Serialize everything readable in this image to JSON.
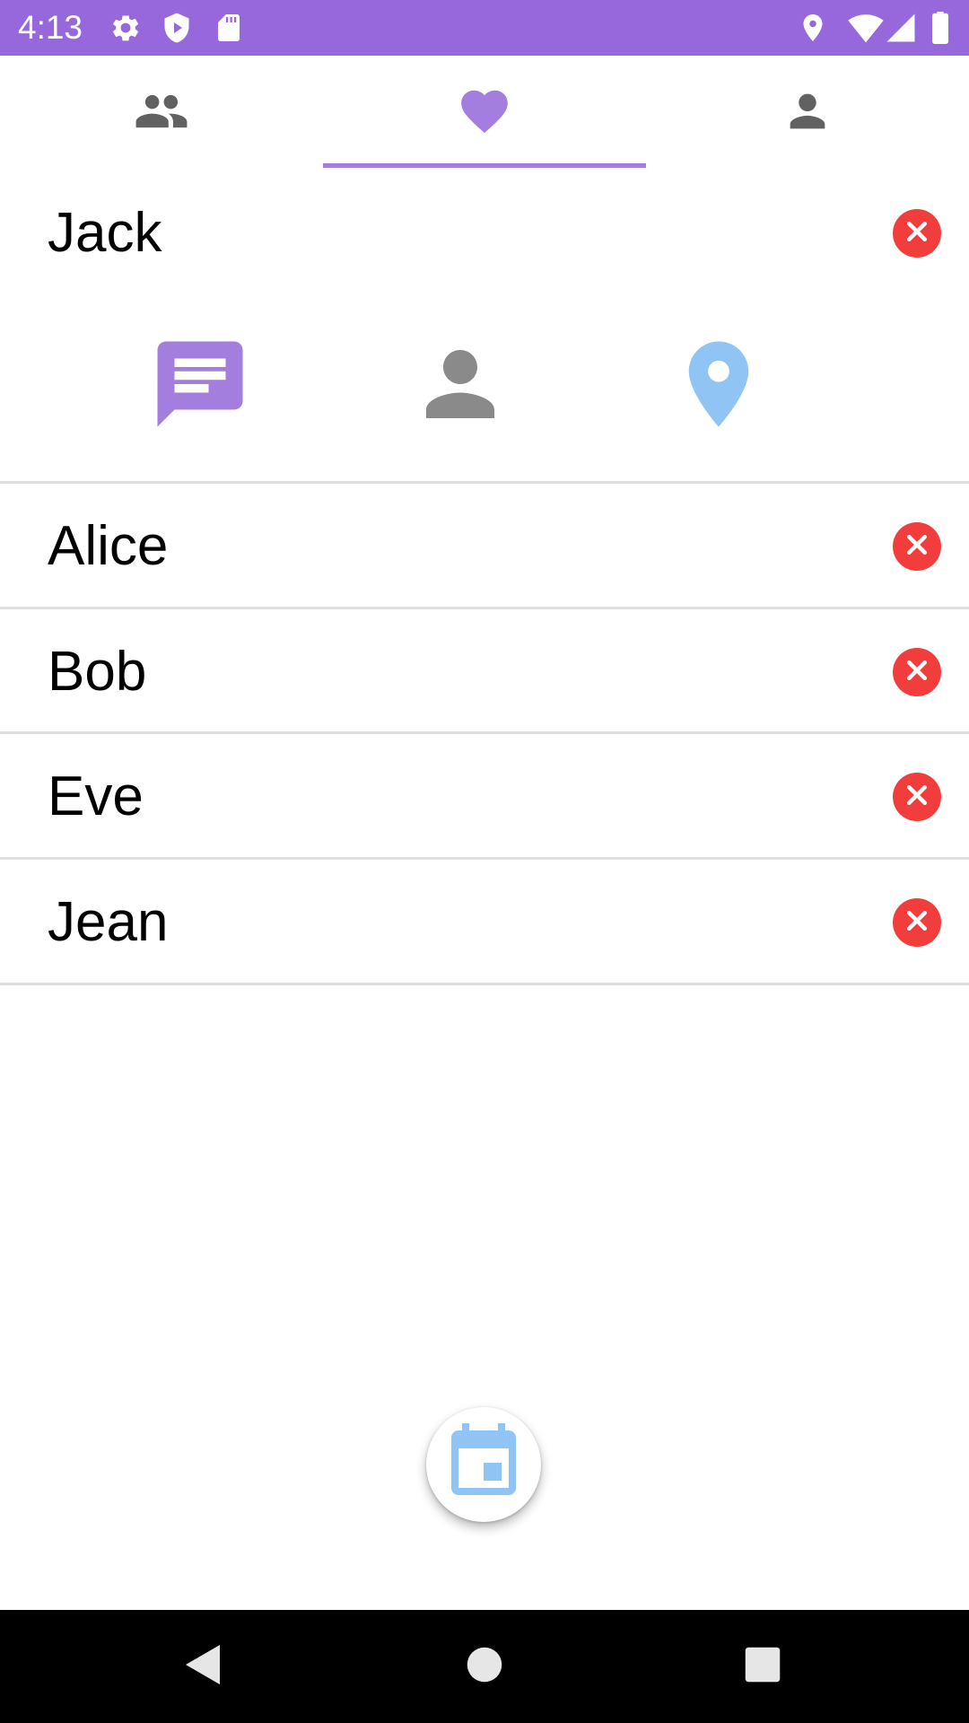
{
  "status_bar": {
    "time": "4:13",
    "left_icons": [
      "gear-icon",
      "shield-play-icon",
      "sd-card-icon"
    ],
    "right_icons": [
      "location-icon",
      "wifi-icon",
      "signal-icon",
      "battery-icon"
    ],
    "background_color": "#9768db"
  },
  "tabs": {
    "items": [
      {
        "icon": "group-icon",
        "selected": false
      },
      {
        "icon": "heart-icon",
        "selected": true
      },
      {
        "icon": "person-icon",
        "selected": false
      }
    ],
    "accent_color": "#a37edf",
    "inactive_color": "#616161"
  },
  "header": {
    "name": "Jack"
  },
  "actions": [
    {
      "icon": "message-icon",
      "color": "#a37edf"
    },
    {
      "icon": "person-icon",
      "color": "#8a8a8a"
    },
    {
      "icon": "location-pin-icon",
      "color": "#90c4f5"
    }
  ],
  "contacts": [
    {
      "name": "Alice"
    },
    {
      "name": "Bob"
    },
    {
      "name": "Eve"
    },
    {
      "name": "Jean"
    }
  ],
  "remove_color": "#f23d3d",
  "fab": {
    "icon": "calendar-icon",
    "color": "#90c4f5"
  },
  "nav_bar": {
    "buttons": [
      "back-icon",
      "home-icon",
      "recents-icon"
    ]
  }
}
